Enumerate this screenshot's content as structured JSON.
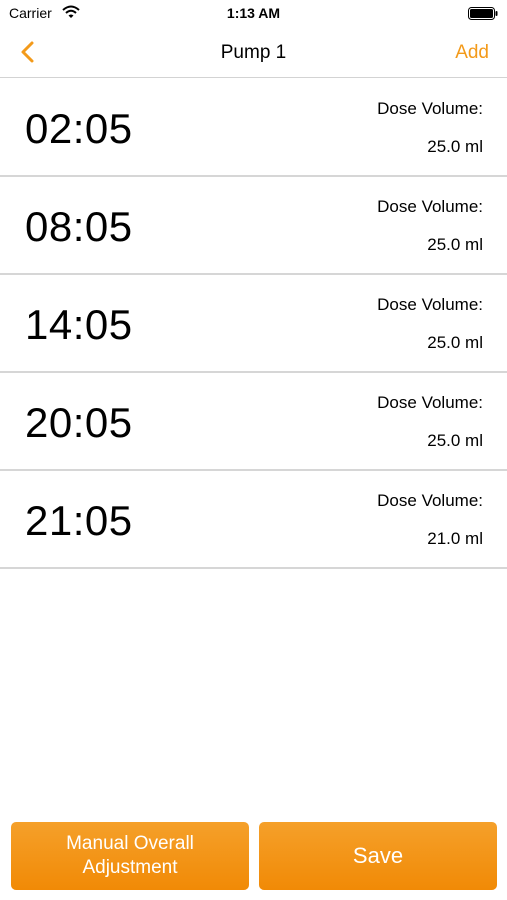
{
  "status_bar": {
    "carrier": "Carrier",
    "time": "1:13 AM"
  },
  "nav": {
    "title": "Pump 1",
    "add_label": "Add",
    "accent_color": "#f39a1a"
  },
  "schedule": [
    {
      "time": "02:05",
      "dose_label": "Dose Volume:",
      "dose_value": "25.0 ml"
    },
    {
      "time": "08:05",
      "dose_label": "Dose Volume:",
      "dose_value": "25.0 ml"
    },
    {
      "time": "14:05",
      "dose_label": "Dose Volume:",
      "dose_value": "25.0 ml"
    },
    {
      "time": "20:05",
      "dose_label": "Dose Volume:",
      "dose_value": "25.0 ml"
    },
    {
      "time": "21:05",
      "dose_label": "Dose Volume:",
      "dose_value": "21.0 ml"
    }
  ],
  "footer": {
    "manual_label": "Manual Overall\nAdjustment",
    "save_label": "Save"
  },
  "icons": {
    "back": "chevron-left-icon",
    "wifi": "wifi-icon",
    "battery": "battery-icon"
  }
}
